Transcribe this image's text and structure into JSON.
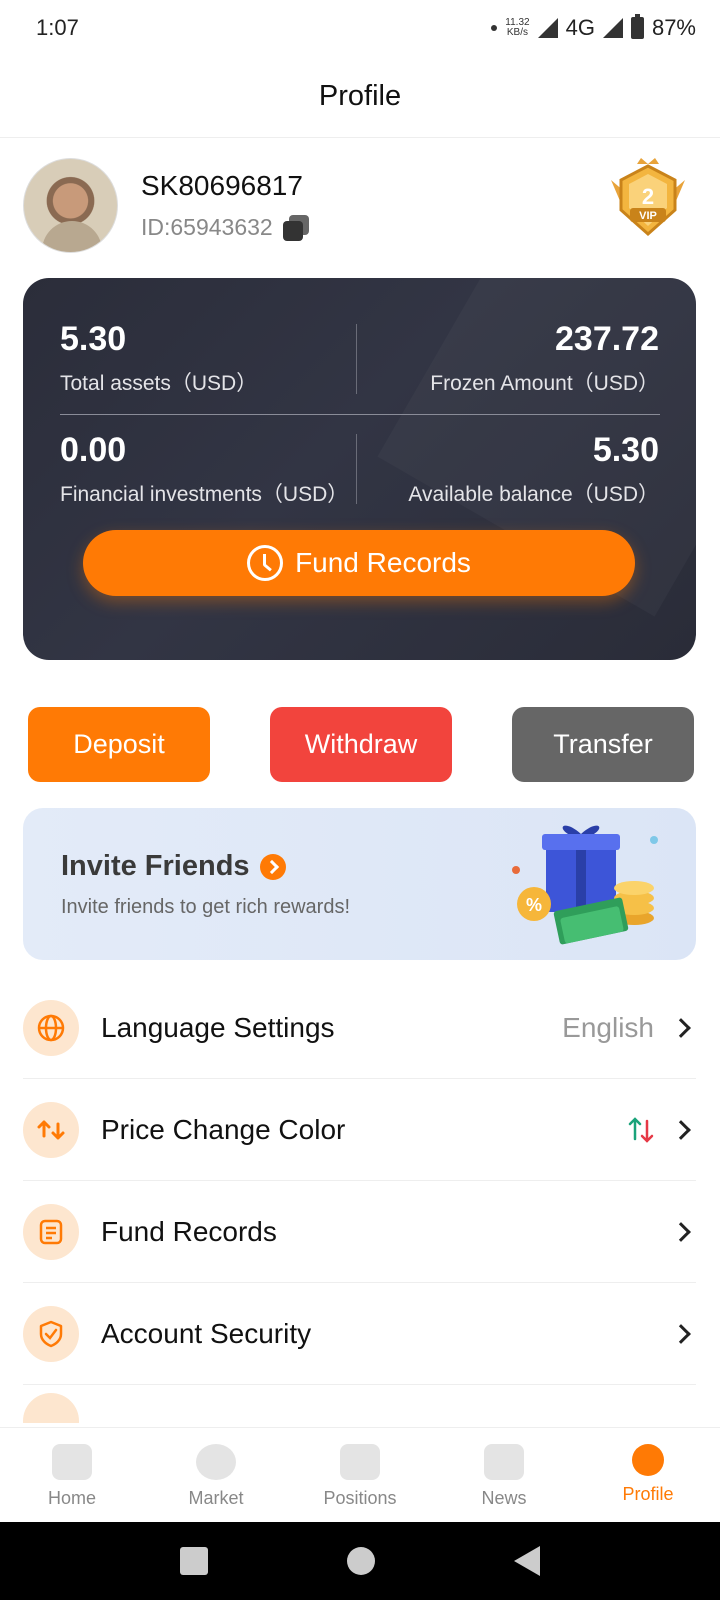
{
  "status_bar": {
    "time": "1:07",
    "net_speed_value": "11.32",
    "net_speed_unit": "KB/s",
    "network": "4G",
    "battery": "87%"
  },
  "header": {
    "title": "Profile"
  },
  "profile": {
    "username": "SK80696817",
    "user_id": "ID:65943632",
    "vip_level": "2",
    "vip_text": "VIP"
  },
  "assets": {
    "total_assets_value": "5.30",
    "total_assets_label": "Total assets（USD）",
    "frozen_value": "237.72",
    "frozen_label": "Frozen Amount（USD）",
    "financial_value": "0.00",
    "financial_label": "Financial investments（USD）",
    "available_value": "5.30",
    "available_label": "Available balance（USD）",
    "fund_records_button": "Fund Records"
  },
  "actions": {
    "deposit": "Deposit",
    "withdraw": "Withdraw",
    "transfer": "Transfer"
  },
  "invite": {
    "title": "Invite Friends",
    "subtitle": "Invite friends to get rich rewards!"
  },
  "settings": [
    {
      "label": "Language Settings",
      "value": "English",
      "icon": "globe-icon"
    },
    {
      "label": "Price Change Color",
      "value": "",
      "icon": "swap-arrows-icon"
    },
    {
      "label": "Fund Records",
      "value": "",
      "icon": "document-icon"
    },
    {
      "label": "Account Security",
      "value": "",
      "icon": "shield-check-icon"
    }
  ],
  "bottom_nav": {
    "home": "Home",
    "market": "Market",
    "positions": "Positions",
    "news": "News",
    "profile": "Profile"
  },
  "colors": {
    "accent": "#ff7a05",
    "withdraw": "#f2443d",
    "transfer": "#666666",
    "card_bg": "#2b2d3a",
    "up": "#1aa37a",
    "down": "#e63946"
  }
}
